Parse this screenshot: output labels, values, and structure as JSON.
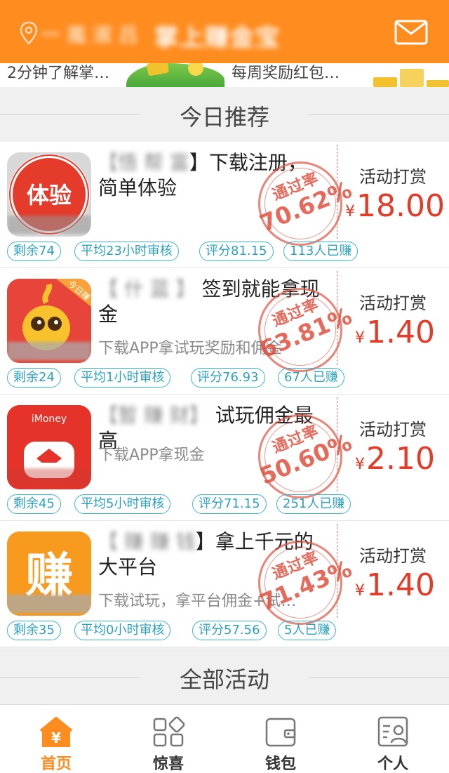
{
  "header": {
    "city": "一 嵐 淑 吕",
    "title": "掌上赚金宝",
    "location_icon": "location-pin-icon",
    "mail_icon": "mail-icon",
    "accent": "#ff8c1f"
  },
  "banner": {
    "left_text": "2分钟了解掌…",
    "right_text": "每周奖励红包…"
  },
  "sections": {
    "today": "今日推荐",
    "all": "全部活动"
  },
  "tasks": [
    {
      "name_blur": "【悟 帮 富",
      "name": "】下载注册，简单体验",
      "desc": "",
      "icon_text": "体验",
      "reward_label": "活动打赏",
      "price": "18.00",
      "currency": "¥",
      "stamp_top": "通过率",
      "stamp_rate": "70.62%",
      "tags": [
        "剩余74",
        "平均23小时审核",
        "评分81.15",
        "113人已赚"
      ]
    },
    {
      "name_blur": "【 什 蓝 】",
      "name": "签到就能拿现金",
      "desc": "下载APP拿试玩奖励和佣金",
      "icon_text": "今日赚",
      "reward_label": "活动打赏",
      "price": "1.40",
      "currency": "¥",
      "stamp_top": "通过率",
      "stamp_rate": "63.81%",
      "tags": [
        "剩余24",
        "平均1小时审核",
        "评分76.93",
        "67人已赚"
      ]
    },
    {
      "name_blur": "【暂 赚 财】",
      "name": "试玩佣金最高",
      "desc": "下载APP拿现金",
      "icon_text": "iMoney",
      "reward_label": "活动打赏",
      "price": "2.10",
      "currency": "¥",
      "stamp_top": "通过率",
      "stamp_rate": "50.60%",
      "tags": [
        "剩余45",
        "平均5小时审核",
        "评分71.15",
        "251人已赚"
      ]
    },
    {
      "name_blur": "【 赚 赚 钱",
      "name": "】拿上千元的大平台",
      "desc": "下载试玩，拿平台佣金+试…",
      "icon_text": "赚",
      "reward_label": "活动打赏",
      "price": "1.40",
      "currency": "¥",
      "stamp_top": "通过率",
      "stamp_rate": "71.43%",
      "tags": [
        "剩余35",
        "平均0小时审核",
        "评分57.56",
        "5人已赚"
      ]
    }
  ],
  "tabbar": {
    "items": [
      {
        "label": "首页",
        "icon": "home-yen-icon",
        "active": true
      },
      {
        "label": "惊喜",
        "icon": "grid-apps-icon",
        "active": false
      },
      {
        "label": "钱包",
        "icon": "wallet-icon",
        "active": false
      },
      {
        "label": "个人",
        "icon": "profile-card-icon",
        "active": false
      }
    ]
  },
  "colors": {
    "accent": "#ff8c1f",
    "price": "#e53a26",
    "tag": "#2ba2bd"
  }
}
